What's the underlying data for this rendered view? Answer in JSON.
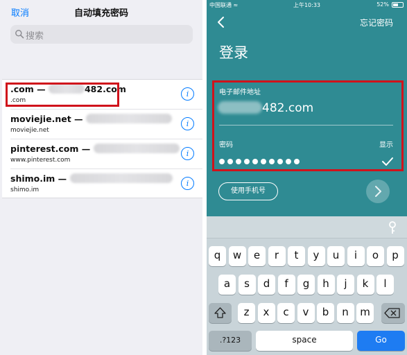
{
  "autofill": {
    "cancel_label": "取消",
    "title": "自动填充密码",
    "search_placeholder": "搜索",
    "rows": [
      {
        "site": ".com —",
        "user_suffix": "482.com",
        "url": ".com"
      },
      {
        "site": "moviejie.net —",
        "user_suffix": "",
        "url": "moviejie.net"
      },
      {
        "site": "pinterest.com —",
        "user_suffix": "",
        "url": "www.pinterest.com"
      },
      {
        "site": "shimo.im —",
        "user_suffix": "",
        "url": "shimo.im"
      }
    ],
    "info_glyph": "i"
  },
  "login": {
    "status": {
      "carrier": "中国联通 ≈",
      "time": "上午10:33",
      "battery": "52%",
      "battery_level": 0.52
    },
    "forgot_label": "忘记密码",
    "title": "登录",
    "email_label": "电子邮件地址",
    "email_suffix": "482.com",
    "password_label": "密码",
    "show_label": "显示",
    "password_length": 10,
    "phone_button_label": "使用手机号"
  },
  "keyboard": {
    "row1": [
      "q",
      "w",
      "e",
      "r",
      "t",
      "y",
      "u",
      "i",
      "o",
      "p"
    ],
    "row2": [
      "a",
      "s",
      "d",
      "f",
      "g",
      "h",
      "j",
      "k",
      "l"
    ],
    "row3": [
      "z",
      "x",
      "c",
      "v",
      "b",
      "n",
      "m"
    ],
    "numbers_label": ".?123",
    "space_label": "space",
    "go_label": "Go"
  },
  "colors": {
    "accent": "#007aff",
    "highlight": "#d0121b",
    "login_bg": "#2f8b93",
    "go_key": "#1e7cf2"
  },
  "icons": [
    "search-icon",
    "info-icon",
    "back-chevron-icon",
    "check-icon",
    "arrow-right-icon",
    "key-icon",
    "shift-icon",
    "backspace-icon"
  ]
}
